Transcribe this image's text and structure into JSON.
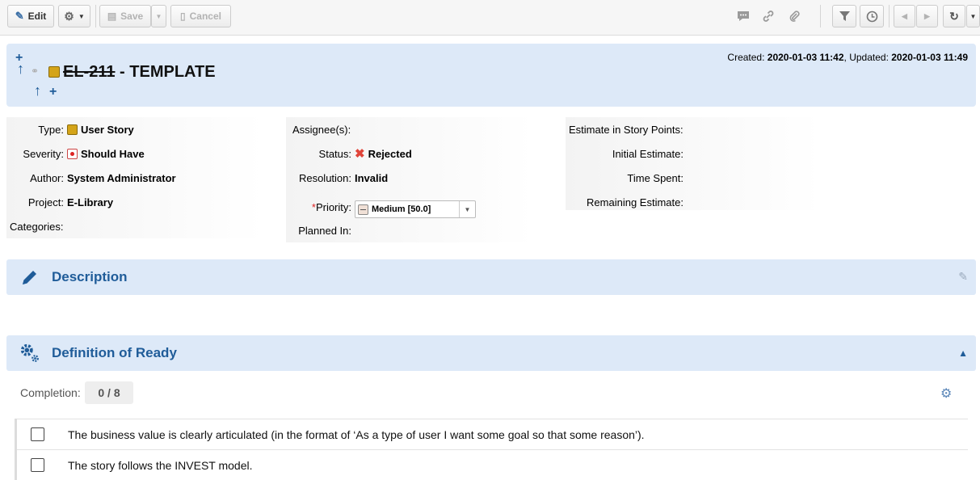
{
  "toolbar": {
    "edit_label": "Edit",
    "save_label": "Save",
    "cancel_label": "Cancel"
  },
  "header": {
    "item_key": "EL-211",
    "item_title": " - TEMPLATE",
    "created_label": "Created:",
    "created_value": "2020-01-03 11:42",
    "updated_label": "Updated:",
    "updated_value": "2020-01-03 11:49"
  },
  "fields": {
    "type_label": "Type:",
    "type_value": "User Story",
    "severity_label": "Severity:",
    "severity_value": "Should Have",
    "author_label": "Author:",
    "author_value": "System Administrator",
    "project_label": "Project:",
    "project_value": "E-Library",
    "categories_label": "Categories:",
    "assignees_label": "Assignee(s):",
    "status_label": "Status:",
    "status_value": "Rejected",
    "resolution_label": "Resolution:",
    "resolution_value": "Invalid",
    "priority_required": "*",
    "priority_label": "Priority:",
    "priority_value": "Medium [50.0]",
    "planned_label": "Planned In:",
    "estimate_sp_label": "Estimate in Story Points:",
    "initial_estimate_label": "Initial Estimate:",
    "time_spent_label": "Time Spent:",
    "remaining_estimate_label": "Remaining Estimate:"
  },
  "sections": {
    "description_title": "Description",
    "dor_title": "Definition of Ready"
  },
  "dor": {
    "completion_label": "Completion:",
    "completion_value": "0 / 8",
    "items": [
      "The business value is clearly articulated (in the format of ‘As a type of user I want some goal so that some reason’).",
      "The story follows the INVEST model."
    ]
  },
  "colors": {
    "accent": "#1f5c99",
    "header_bg": "#dde9f8",
    "rejected": "#e0453a"
  }
}
